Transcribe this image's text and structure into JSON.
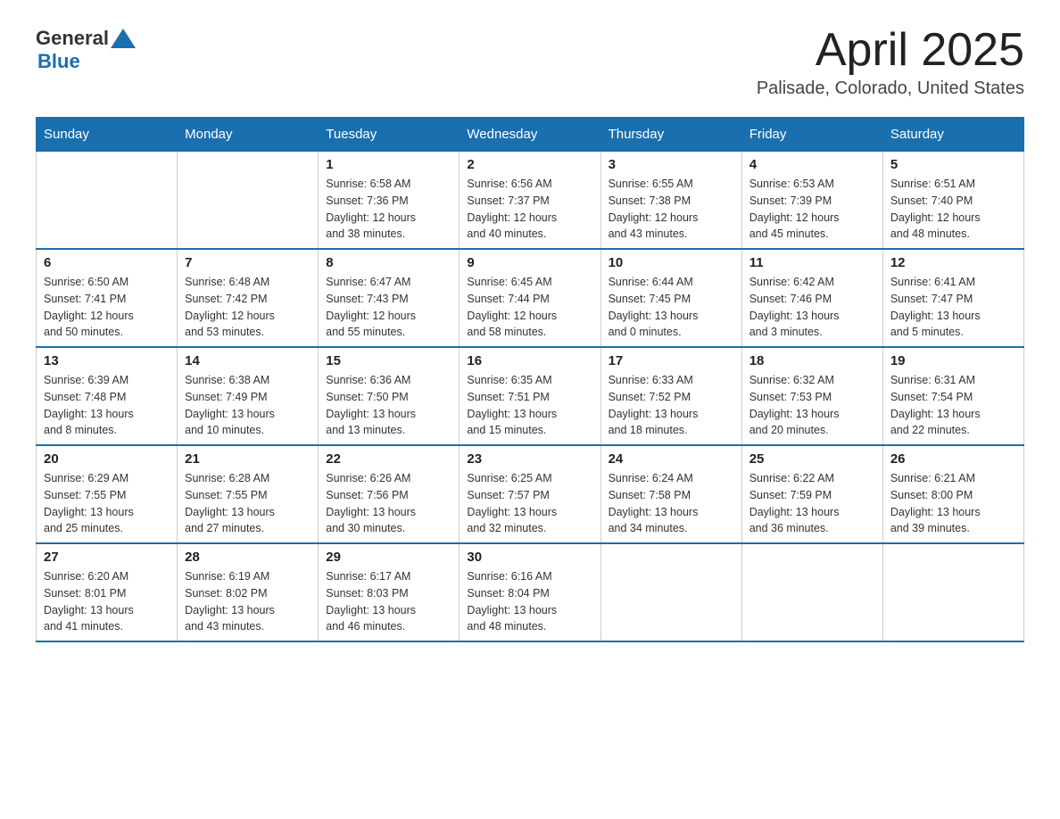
{
  "header": {
    "logo_general": "General",
    "logo_blue": "Blue",
    "month": "April 2025",
    "location": "Palisade, Colorado, United States"
  },
  "days_of_week": [
    "Sunday",
    "Monday",
    "Tuesday",
    "Wednesday",
    "Thursday",
    "Friday",
    "Saturday"
  ],
  "weeks": [
    [
      {
        "day": "",
        "info": ""
      },
      {
        "day": "",
        "info": ""
      },
      {
        "day": "1",
        "info": "Sunrise: 6:58 AM\nSunset: 7:36 PM\nDaylight: 12 hours\nand 38 minutes."
      },
      {
        "day": "2",
        "info": "Sunrise: 6:56 AM\nSunset: 7:37 PM\nDaylight: 12 hours\nand 40 minutes."
      },
      {
        "day": "3",
        "info": "Sunrise: 6:55 AM\nSunset: 7:38 PM\nDaylight: 12 hours\nand 43 minutes."
      },
      {
        "day": "4",
        "info": "Sunrise: 6:53 AM\nSunset: 7:39 PM\nDaylight: 12 hours\nand 45 minutes."
      },
      {
        "day": "5",
        "info": "Sunrise: 6:51 AM\nSunset: 7:40 PM\nDaylight: 12 hours\nand 48 minutes."
      }
    ],
    [
      {
        "day": "6",
        "info": "Sunrise: 6:50 AM\nSunset: 7:41 PM\nDaylight: 12 hours\nand 50 minutes."
      },
      {
        "day": "7",
        "info": "Sunrise: 6:48 AM\nSunset: 7:42 PM\nDaylight: 12 hours\nand 53 minutes."
      },
      {
        "day": "8",
        "info": "Sunrise: 6:47 AM\nSunset: 7:43 PM\nDaylight: 12 hours\nand 55 minutes."
      },
      {
        "day": "9",
        "info": "Sunrise: 6:45 AM\nSunset: 7:44 PM\nDaylight: 12 hours\nand 58 minutes."
      },
      {
        "day": "10",
        "info": "Sunrise: 6:44 AM\nSunset: 7:45 PM\nDaylight: 13 hours\nand 0 minutes."
      },
      {
        "day": "11",
        "info": "Sunrise: 6:42 AM\nSunset: 7:46 PM\nDaylight: 13 hours\nand 3 minutes."
      },
      {
        "day": "12",
        "info": "Sunrise: 6:41 AM\nSunset: 7:47 PM\nDaylight: 13 hours\nand 5 minutes."
      }
    ],
    [
      {
        "day": "13",
        "info": "Sunrise: 6:39 AM\nSunset: 7:48 PM\nDaylight: 13 hours\nand 8 minutes."
      },
      {
        "day": "14",
        "info": "Sunrise: 6:38 AM\nSunset: 7:49 PM\nDaylight: 13 hours\nand 10 minutes."
      },
      {
        "day": "15",
        "info": "Sunrise: 6:36 AM\nSunset: 7:50 PM\nDaylight: 13 hours\nand 13 minutes."
      },
      {
        "day": "16",
        "info": "Sunrise: 6:35 AM\nSunset: 7:51 PM\nDaylight: 13 hours\nand 15 minutes."
      },
      {
        "day": "17",
        "info": "Sunrise: 6:33 AM\nSunset: 7:52 PM\nDaylight: 13 hours\nand 18 minutes."
      },
      {
        "day": "18",
        "info": "Sunrise: 6:32 AM\nSunset: 7:53 PM\nDaylight: 13 hours\nand 20 minutes."
      },
      {
        "day": "19",
        "info": "Sunrise: 6:31 AM\nSunset: 7:54 PM\nDaylight: 13 hours\nand 22 minutes."
      }
    ],
    [
      {
        "day": "20",
        "info": "Sunrise: 6:29 AM\nSunset: 7:55 PM\nDaylight: 13 hours\nand 25 minutes."
      },
      {
        "day": "21",
        "info": "Sunrise: 6:28 AM\nSunset: 7:55 PM\nDaylight: 13 hours\nand 27 minutes."
      },
      {
        "day": "22",
        "info": "Sunrise: 6:26 AM\nSunset: 7:56 PM\nDaylight: 13 hours\nand 30 minutes."
      },
      {
        "day": "23",
        "info": "Sunrise: 6:25 AM\nSunset: 7:57 PM\nDaylight: 13 hours\nand 32 minutes."
      },
      {
        "day": "24",
        "info": "Sunrise: 6:24 AM\nSunset: 7:58 PM\nDaylight: 13 hours\nand 34 minutes."
      },
      {
        "day": "25",
        "info": "Sunrise: 6:22 AM\nSunset: 7:59 PM\nDaylight: 13 hours\nand 36 minutes."
      },
      {
        "day": "26",
        "info": "Sunrise: 6:21 AM\nSunset: 8:00 PM\nDaylight: 13 hours\nand 39 minutes."
      }
    ],
    [
      {
        "day": "27",
        "info": "Sunrise: 6:20 AM\nSunset: 8:01 PM\nDaylight: 13 hours\nand 41 minutes."
      },
      {
        "day": "28",
        "info": "Sunrise: 6:19 AM\nSunset: 8:02 PM\nDaylight: 13 hours\nand 43 minutes."
      },
      {
        "day": "29",
        "info": "Sunrise: 6:17 AM\nSunset: 8:03 PM\nDaylight: 13 hours\nand 46 minutes."
      },
      {
        "day": "30",
        "info": "Sunrise: 6:16 AM\nSunset: 8:04 PM\nDaylight: 13 hours\nand 48 minutes."
      },
      {
        "day": "",
        "info": ""
      },
      {
        "day": "",
        "info": ""
      },
      {
        "day": "",
        "info": ""
      }
    ]
  ]
}
